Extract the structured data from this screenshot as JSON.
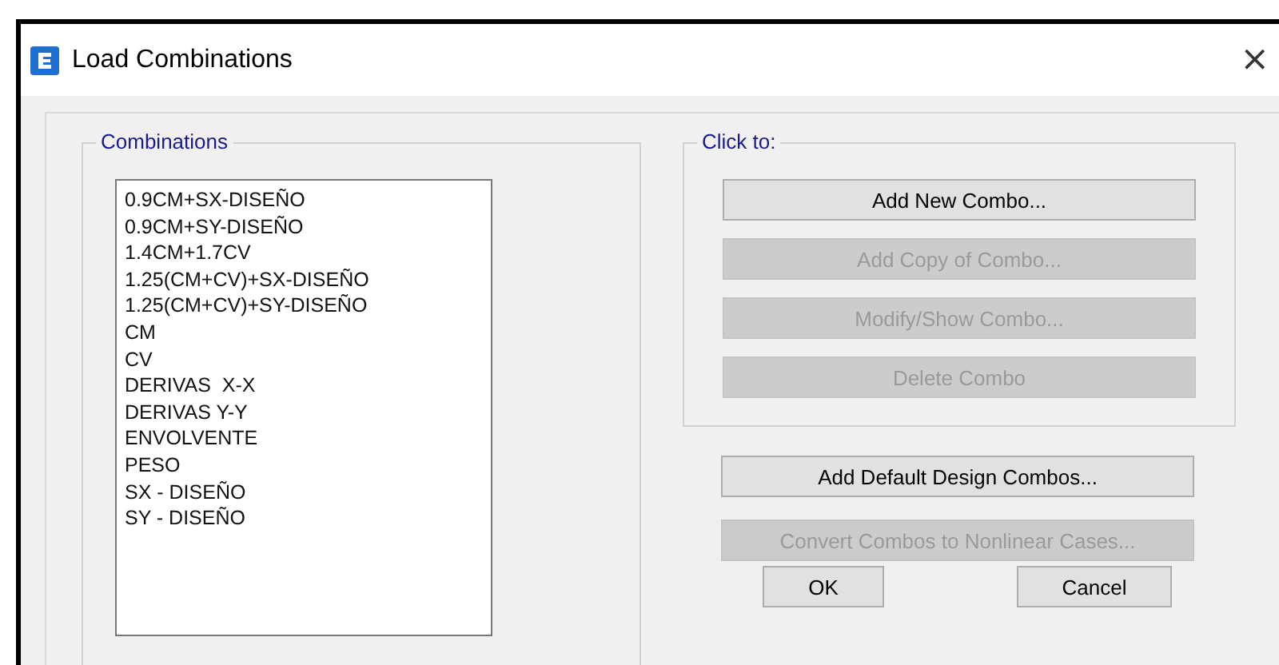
{
  "window": {
    "title": "Load Combinations",
    "close": "×"
  },
  "combinations": {
    "title": "Combinations",
    "items": [
      "0.9CM+SX-DISEÑO",
      "0.9CM+SY-DISEÑO",
      "1.4CM+1.7CV",
      "1.25(CM+CV)+SX-DISEÑO",
      "1.25(CM+CV)+SY-DISEÑO",
      "CM",
      "CV",
      "DERIVAS  X-X",
      "DERIVAS Y-Y",
      "ENVOLVENTE",
      "PESO",
      "SX - DISEÑO",
      "SY - DISEÑO"
    ]
  },
  "click_to": {
    "title": "Click to:",
    "buttons": [
      {
        "label": "Add New Combo...",
        "disabled": false
      },
      {
        "label": "Add Copy of Combo...",
        "disabled": true
      },
      {
        "label": "Modify/Show Combo...",
        "disabled": true
      },
      {
        "label": "Delete Combo",
        "disabled": true
      }
    ]
  },
  "extra_buttons": [
    {
      "label": "Add Default Design Combos...",
      "disabled": false
    },
    {
      "label": "Convert Combos to Nonlinear Cases...",
      "disabled": true
    }
  ],
  "dialog_buttons": [
    "OK",
    "Cancel"
  ]
}
